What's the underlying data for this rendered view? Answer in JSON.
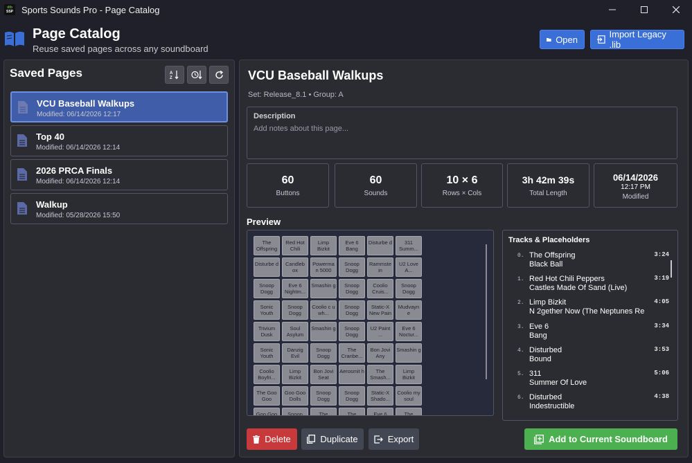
{
  "window": {
    "title": "Sports Sounds Pro - Page Catalog",
    "logo_top": "dtb",
    "logo_bottom": "SSP"
  },
  "header": {
    "title": "Page Catalog",
    "subtitle": "Reuse saved pages across any soundboard",
    "open_label": "Open",
    "import_label": "Import Legacy .lib"
  },
  "saved": {
    "title": "Saved Pages",
    "items": [
      {
        "name": "VCU Baseball Walkups",
        "modified": "Modified: 06/14/2026 12:17"
      },
      {
        "name": "Top 40",
        "modified": "Modified: 06/14/2026 12:14"
      },
      {
        "name": "2026 PRCA Finals",
        "modified": "Modified: 06/14/2026 12:14"
      },
      {
        "name": "Walkup",
        "modified": "Modified: 05/28/2026 15:50"
      }
    ]
  },
  "detail": {
    "title": "VCU Baseball Walkups",
    "meta": "Set: Release_8.1 • Group: A",
    "description_label": "Description",
    "description_placeholder": "Add notes about this page...",
    "stats": [
      {
        "value": "60",
        "label": "Buttons"
      },
      {
        "value": "60",
        "label": "Sounds"
      },
      {
        "value": "10 × 6",
        "label": "Rows × Cols"
      },
      {
        "value": "3h 42m 39s",
        "label": "Total Length"
      },
      {
        "value": "06/14/2026",
        "value2": "12:17 PM",
        "label": "Modified"
      }
    ],
    "preview_label": "Preview",
    "preview_cells": [
      "The Offspring",
      "Red Hot Chili",
      "Limp Bizkit",
      "Eve 6 Bang",
      "Disturbe d",
      "311 Summ...",
      "Disturbe d",
      "Candleb ox",
      "Powerma n 5000",
      "Snoop Dogg",
      "Rammste in",
      "U2 Love A...",
      "Snoop Dogg",
      "Eve 6 Nightm...",
      "Smashin g",
      "Snoop Dogg",
      "Coolio Cruis...",
      "Snoop Dogg",
      "Sonic Youth",
      "Snoop Dogg",
      "Coolio c u wh...",
      "Snoop Dogg",
      "Static-X New Pain",
      "Mudvayn e",
      "Trivium Dusk",
      "Soul Asylum",
      "Smashin g",
      "Snoop Dogg",
      "U2 Paint ...",
      "Eve 6 Noctur...",
      "Sonic Youth",
      "Danzig Evil",
      "Snoop Dogg",
      "The Cranbe...",
      "Bon Jovi Any",
      "Smashin g",
      "Coolio Boyfri...",
      "Limp Bizkit",
      "Bon Jovi Seat",
      "Aerosmit h",
      "The Smash...",
      "Limp Bizkit",
      "The Goo Goo",
      "Goo Goo Dolls",
      "Snoop Dogg",
      "Snoop Dogg",
      "Static-X Shado...",
      "Coolio my soul",
      "Goo Goo",
      "Snoop",
      "The",
      "The",
      "Eve 6",
      "The"
    ],
    "tracks_label": "Tracks & Placeholders",
    "tracks": [
      {
        "n": "0.",
        "artist": "The Offspring",
        "title": "Black Ball",
        "dur": "3:24"
      },
      {
        "n": "1.",
        "artist": "Red Hot Chili Peppers",
        "title": "Castles Made Of Sand (Live)",
        "dur": "3:19"
      },
      {
        "n": "2.",
        "artist": "Limp Bizkit",
        "title": "N 2gether Now (The Neptunes Re",
        "dur": "4:05"
      },
      {
        "n": "3.",
        "artist": "Eve 6",
        "title": "Bang",
        "dur": "3:34"
      },
      {
        "n": "4.",
        "artist": "Disturbed",
        "title": "Bound",
        "dur": "3:53"
      },
      {
        "n": "5.",
        "artist": "311",
        "title": "Summer Of Love",
        "dur": "5:06"
      },
      {
        "n": "6.",
        "artist": "Disturbed",
        "title": "Indestructible",
        "dur": "4:38"
      }
    ],
    "delete_label": "Delete",
    "duplicate_label": "Duplicate",
    "export_label": "Export",
    "add_label": "Add to Current Soundboard"
  },
  "colors": {
    "accent": "#3a6fd8",
    "danger": "#c8393b",
    "success": "#4caf50",
    "selected": "#3f5da8"
  }
}
